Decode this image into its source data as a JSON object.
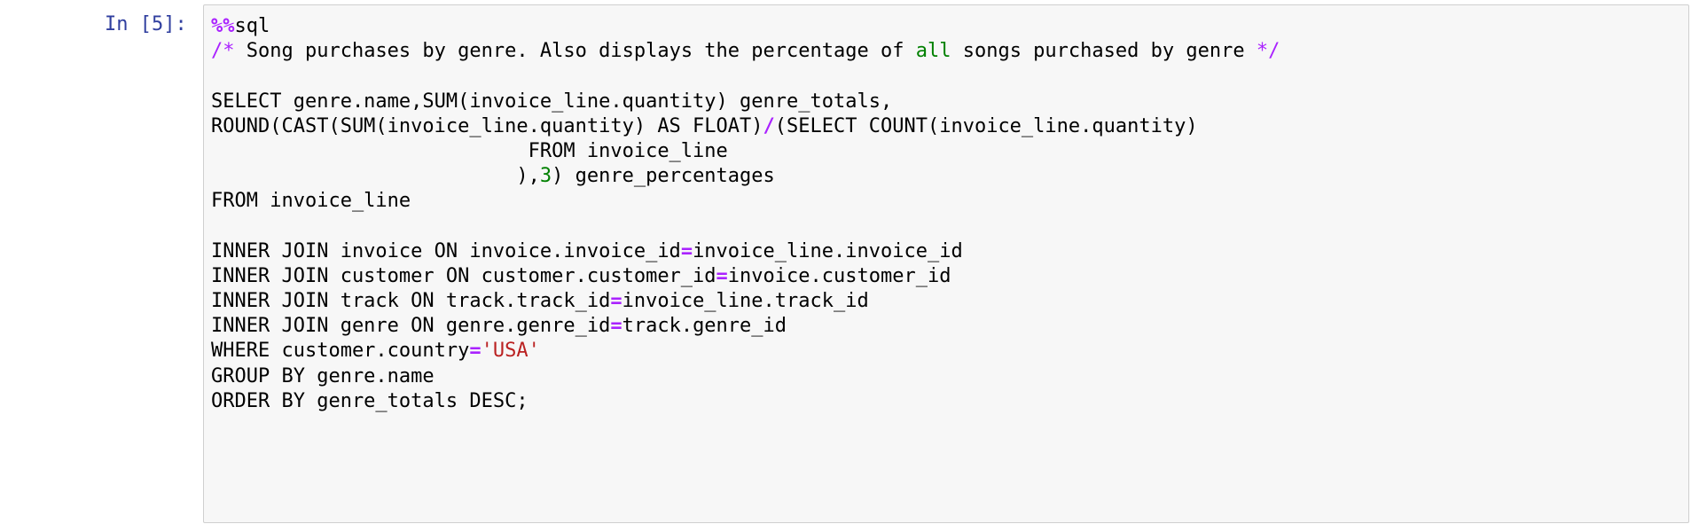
{
  "cell": {
    "prompt": "In [5]:",
    "lines": [
      [
        {
          "t": "%%",
          "c": "magic"
        },
        {
          "t": "sql",
          "c": "plain"
        }
      ],
      [
        {
          "t": "/*",
          "c": "comment-mark"
        },
        {
          "t": " Song purchases by genre. Also displays the percentage of ",
          "c": "plain"
        },
        {
          "t": "all",
          "c": "kw-green"
        },
        {
          "t": " songs purchased by genre ",
          "c": "plain"
        },
        {
          "t": "*/",
          "c": "comment-mark"
        }
      ],
      [],
      [
        {
          "t": "SELECT genre.name,SUM(invoice_line.quantity) genre_totals,",
          "c": "plain"
        }
      ],
      [
        {
          "t": "ROUND(CAST(SUM(invoice_line.quantity) AS FLOAT)",
          "c": "plain"
        },
        {
          "t": "/",
          "c": "op"
        },
        {
          "t": "(SELECT COUNT(invoice_line.quantity)",
          "c": "plain"
        }
      ],
      [
        {
          "t": "                           FROM invoice_line",
          "c": "plain"
        }
      ],
      [
        {
          "t": "                          ),",
          "c": "plain"
        },
        {
          "t": "3",
          "c": "num"
        },
        {
          "t": ") genre_percentages",
          "c": "plain"
        }
      ],
      [
        {
          "t": "FROM invoice_line",
          "c": "plain"
        }
      ],
      [],
      [
        {
          "t": "INNER JOIN invoice ON invoice.invoice_id",
          "c": "plain"
        },
        {
          "t": "=",
          "c": "op"
        },
        {
          "t": "invoice_line.invoice_id",
          "c": "plain"
        }
      ],
      [
        {
          "t": "INNER JOIN customer ON customer.customer_id",
          "c": "plain"
        },
        {
          "t": "=",
          "c": "op"
        },
        {
          "t": "invoice.customer_id",
          "c": "plain"
        }
      ],
      [
        {
          "t": "INNER JOIN track ON track.track_id",
          "c": "plain"
        },
        {
          "t": "=",
          "c": "op"
        },
        {
          "t": "invoice_line.track_id",
          "c": "plain"
        }
      ],
      [
        {
          "t": "INNER JOIN genre ON genre.genre_id",
          "c": "plain"
        },
        {
          "t": "=",
          "c": "op"
        },
        {
          "t": "track.genre_id",
          "c": "plain"
        }
      ],
      [
        {
          "t": "WHERE customer.country",
          "c": "plain"
        },
        {
          "t": "=",
          "c": "op"
        },
        {
          "t": "'USA'",
          "c": "str"
        }
      ],
      [
        {
          "t": "GROUP BY genre.name",
          "c": "plain"
        }
      ],
      [
        {
          "t": "ORDER BY genre_totals DESC;",
          "c": "plain"
        }
      ]
    ]
  },
  "colors": {
    "prompt": "#303f9f",
    "editor_bg": "#f7f7f7",
    "editor_border": "#cfcfcf",
    "magic_op": "#aa22ff",
    "keyword_number": "#008000",
    "string": "#ba2121"
  }
}
